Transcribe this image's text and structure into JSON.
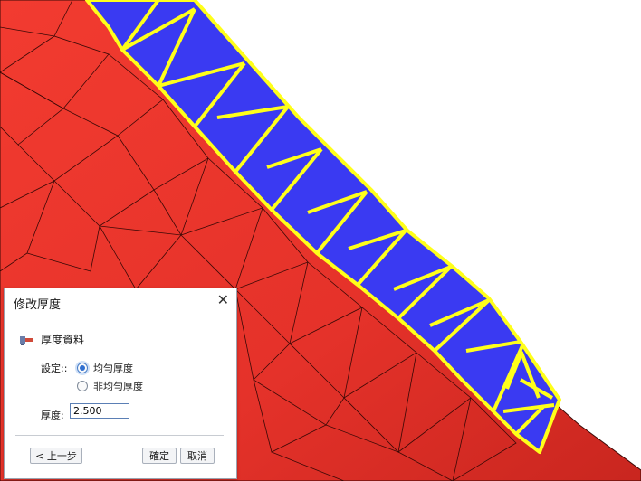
{
  "dialog": {
    "title": "修改厚度",
    "section_title": "厚度資料",
    "setting_label": "設定::",
    "options": [
      {
        "label": "均勻厚度",
        "checked": true
      },
      {
        "label": "非均勻厚度",
        "checked": false
      }
    ],
    "thickness_label": "厚度:",
    "thickness_value": "2.500",
    "back_button": "< 上一步",
    "ok_button": "確定",
    "cancel_button": "取消"
  },
  "icons": {
    "close": "close-icon",
    "section": "thickness-tool-icon"
  },
  "colors": {
    "mesh_fill": "#e8332b",
    "mesh_edge": "#4a0a08",
    "selected_fill": "#3a3af2",
    "selected_edge": "#ffff1a",
    "background": "#ffffff"
  }
}
